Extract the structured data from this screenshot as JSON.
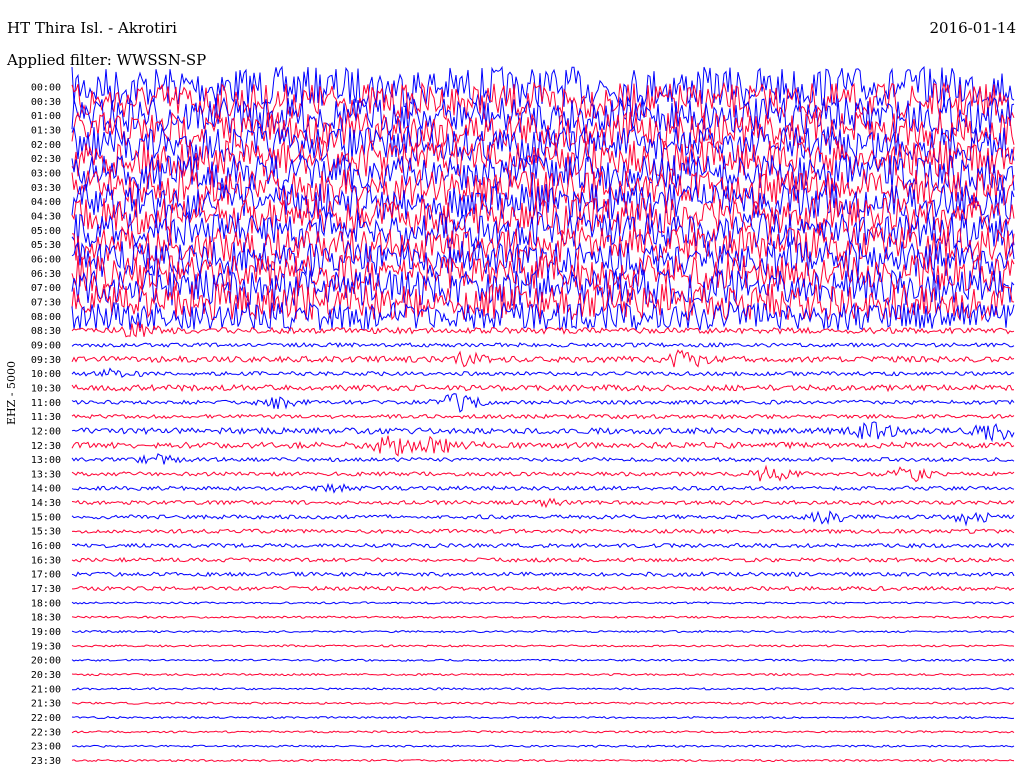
{
  "header": {
    "station": "HT Thira Isl. - Akrotiri",
    "date": "2016-01-14",
    "filter": "Applied filter: WWSSN-SP",
    "channel": "EHZ - 5000"
  },
  "colors": {
    "odd": "#0000ff",
    "even": "#ff0033",
    "background": "#ffffff"
  },
  "chart_data": {
    "type": "line",
    "title": "HT Thira Isl. - Akrotiri",
    "ylabel": "EHZ - 5000",
    "tick_labels": [
      "00:00",
      "00:30",
      "01:00",
      "01:30",
      "02:00",
      "02:30",
      "03:00",
      "03:30",
      "04:00",
      "04:30",
      "05:00",
      "05:30",
      "06:00",
      "06:30",
      "07:00",
      "07:30",
      "08:00",
      "08:30",
      "09:00",
      "09:30",
      "10:00",
      "10:30",
      "11:00",
      "11:30",
      "12:00",
      "12:30",
      "13:00",
      "13:30",
      "14:00",
      "14:30",
      "15:00",
      "15:30",
      "16:00",
      "16:30",
      "17:00",
      "17:30",
      "18:00",
      "18:30",
      "19:00",
      "19:30",
      "20:00",
      "20:30",
      "21:00",
      "21:30",
      "22:00",
      "22:30",
      "23:00",
      "23:30"
    ],
    "trace_amplitude": [
      20,
      18,
      18,
      18,
      18,
      18,
      18,
      18,
      18,
      18,
      18,
      18,
      18,
      18,
      18,
      18,
      14,
      3,
      2,
      3,
      2,
      3,
      2,
      2,
      3,
      3,
      2,
      2,
      2,
      2,
      2,
      2,
      2,
      2,
      2,
      2,
      1,
      1,
      1,
      1,
      1,
      1,
      1,
      1,
      1,
      1,
      1,
      1
    ],
    "events": [
      {
        "row": 17,
        "pos": 0.07,
        "amp": 6
      },
      {
        "row": 19,
        "pos": 0.42,
        "amp": 6
      },
      {
        "row": 19,
        "pos": 0.65,
        "amp": 7
      },
      {
        "row": 20,
        "pos": 0.05,
        "amp": 4
      },
      {
        "row": 22,
        "pos": 0.22,
        "amp": 5
      },
      {
        "row": 22,
        "pos": 0.41,
        "amp": 8
      },
      {
        "row": 24,
        "pos": 0.85,
        "amp": 8
      },
      {
        "row": 24,
        "pos": 0.98,
        "amp": 8
      },
      {
        "row": 25,
        "pos": 0.34,
        "amp": 8
      },
      {
        "row": 25,
        "pos": 0.39,
        "amp": 8
      },
      {
        "row": 26,
        "pos": 0.09,
        "amp": 4
      },
      {
        "row": 27,
        "pos": 0.74,
        "amp": 7
      },
      {
        "row": 27,
        "pos": 0.89,
        "amp": 7
      },
      {
        "row": 28,
        "pos": 0.28,
        "amp": 3
      },
      {
        "row": 29,
        "pos": 0.5,
        "amp": 3
      },
      {
        "row": 30,
        "pos": 0.8,
        "amp": 5
      },
      {
        "row": 30,
        "pos": 0.95,
        "amp": 7
      }
    ]
  }
}
